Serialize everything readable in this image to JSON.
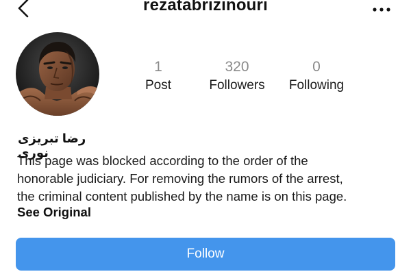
{
  "header": {
    "username": "rezatabrizinouri",
    "back_icon": "chevron-left-icon",
    "more_icon": "more-horizontal-icon"
  },
  "profile": {
    "avatar": "profile-photo",
    "stats": [
      {
        "value": "1",
        "label": "Post"
      },
      {
        "value": "320",
        "label": "Followers"
      },
      {
        "value": "0",
        "label": "Following"
      }
    ],
    "display_name": "رضا تبریزی نوری",
    "bio_lines": [
      "This page was blocked according to the order of the",
      "honorable judiciary. For removing the rumors of the arrest,",
      "the criminal content published by the name is on this page."
    ],
    "see_original": "See Original"
  },
  "actions": {
    "follow_label": "Follow"
  },
  "colors": {
    "accent": "#4495ec",
    "stat_number": "#8a8a8a",
    "text": "#1a1a1a"
  }
}
